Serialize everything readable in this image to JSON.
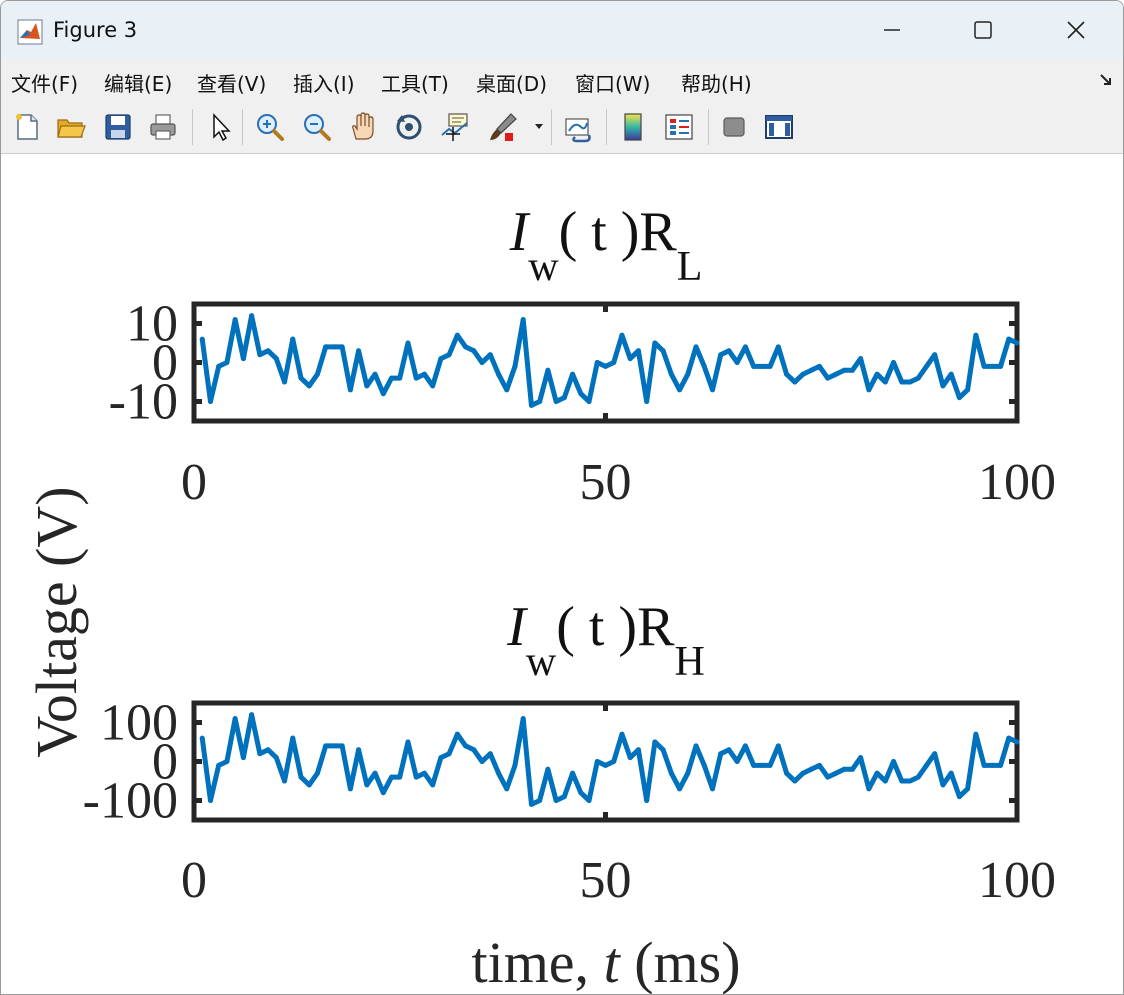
{
  "window": {
    "title": "Figure 3"
  },
  "menu": [
    {
      "label": "文件(F)"
    },
    {
      "label": "编辑(E)"
    },
    {
      "label": "查看(V)"
    },
    {
      "label": "插入(I)"
    },
    {
      "label": "工具(T)"
    },
    {
      "label": "桌面(D)"
    },
    {
      "label": "窗口(W)"
    },
    {
      "label": "帮助(H)"
    }
  ],
  "toolbar": {
    "icons": [
      "new-figure-icon",
      "open-icon",
      "save-icon",
      "print-icon",
      "pointer-icon",
      "zoom-in-icon",
      "zoom-out-icon",
      "pan-icon",
      "rotate-3d-icon",
      "data-cursor-icon",
      "brush-icon",
      "brush-dropdown-icon",
      "link-plot-icon",
      "colorbar-icon",
      "legend-icon",
      "hide-plot-tools-icon",
      "show-plot-tools-icon"
    ]
  },
  "colors": {
    "line": "#0072bd",
    "axes": "#262626",
    "titlebar": "#e9f1f7",
    "menubar": "#f0f0f0"
  },
  "figure": {
    "ylabel": "Voltage (V)",
    "xlabel": "time, t (ms)"
  },
  "chart_data": [
    {
      "type": "line",
      "title": "I_w( t )R_L",
      "title_parts": {
        "main": "I",
        "sub": "w",
        "mid": "( t )R",
        "sub2": "L"
      },
      "xlim": [
        0,
        100
      ],
      "ylim": [
        -15,
        15
      ],
      "xticks": [
        0,
        50,
        100
      ],
      "xtick_labels": [
        "0",
        "50",
        "100"
      ],
      "yticks": [
        10,
        0,
        -10
      ],
      "ytick_labels": [
        "10",
        "0",
        "-10"
      ],
      "x": [
        1,
        2,
        3,
        4,
        5,
        6,
        7,
        8,
        9,
        10,
        11,
        12,
        13,
        14,
        15,
        16,
        17,
        18,
        19,
        20,
        21,
        22,
        23,
        24,
        25,
        26,
        27,
        28,
        29,
        30,
        31,
        32,
        33,
        34,
        35,
        36,
        37,
        38,
        39,
        40,
        41,
        42,
        43,
        44,
        45,
        46,
        47,
        48,
        49,
        50,
        51,
        52,
        53,
        54,
        55,
        56,
        57,
        58,
        59,
        60,
        61,
        62,
        63,
        64,
        65,
        66,
        67,
        68,
        69,
        70,
        71,
        72,
        73,
        74,
        75,
        76,
        77,
        78,
        79,
        80,
        81,
        82,
        83,
        84,
        85,
        86,
        87,
        88,
        89,
        90,
        91,
        92,
        93,
        94,
        95,
        96,
        97,
        98,
        99,
        100
      ],
      "series": [
        {
          "values": [
            6,
            -10,
            -1,
            0,
            11,
            1,
            12,
            2,
            3,
            1,
            -5,
            6,
            -4,
            -6,
            -3,
            4,
            4,
            4,
            -7,
            3,
            -6,
            -3,
            -8,
            -4,
            -4,
            5,
            -4,
            -3,
            -6,
            1,
            2,
            7,
            4,
            3,
            0,
            2,
            -3,
            -7,
            -1,
            11,
            -11,
            -10,
            -2,
            -10,
            -9,
            -3,
            -8,
            -10,
            0,
            -1,
            0,
            7,
            1,
            3,
            -10,
            5,
            3,
            -3,
            -7,
            -3,
            4,
            -1,
            -7,
            2,
            3,
            0,
            4,
            -1,
            -1,
            -1,
            4,
            -3,
            -5,
            -3,
            -2,
            -1,
            -4,
            -3,
            -2,
            -2,
            1,
            -7,
            -3,
            -5,
            0,
            -5,
            -5,
            -4,
            -1,
            2,
            -6,
            -3,
            -9,
            -7,
            7,
            -1,
            -1,
            -1,
            6,
            5
          ]
        }
      ]
    },
    {
      "type": "line",
      "title": "I_w( t )R_H",
      "title_parts": {
        "main": "I",
        "sub": "w",
        "mid": "( t )R",
        "sub2": "H"
      },
      "xlim": [
        0,
        100
      ],
      "ylim": [
        -150,
        150
      ],
      "xticks": [
        0,
        50,
        100
      ],
      "xtick_labels": [
        "0",
        "50",
        "100"
      ],
      "yticks": [
        100,
        0,
        -100
      ],
      "ytick_labels": [
        "100",
        "0",
        "-100"
      ],
      "x": [
        1,
        2,
        3,
        4,
        5,
        6,
        7,
        8,
        9,
        10,
        11,
        12,
        13,
        14,
        15,
        16,
        17,
        18,
        19,
        20,
        21,
        22,
        23,
        24,
        25,
        26,
        27,
        28,
        29,
        30,
        31,
        32,
        33,
        34,
        35,
        36,
        37,
        38,
        39,
        40,
        41,
        42,
        43,
        44,
        45,
        46,
        47,
        48,
        49,
        50,
        51,
        52,
        53,
        54,
        55,
        56,
        57,
        58,
        59,
        60,
        61,
        62,
        63,
        64,
        65,
        66,
        67,
        68,
        69,
        70,
        71,
        72,
        73,
        74,
        75,
        76,
        77,
        78,
        79,
        80,
        81,
        82,
        83,
        84,
        85,
        86,
        87,
        88,
        89,
        90,
        91,
        92,
        93,
        94,
        95,
        96,
        97,
        98,
        99,
        100
      ],
      "series": [
        {
          "values": [
            60,
            -100,
            -10,
            0,
            110,
            10,
            120,
            20,
            30,
            10,
            -50,
            60,
            -40,
            -60,
            -30,
            40,
            40,
            40,
            -70,
            30,
            -60,
            -30,
            -80,
            -40,
            -40,
            50,
            -40,
            -30,
            -60,
            10,
            20,
            70,
            40,
            30,
            0,
            20,
            -30,
            -70,
            -10,
            110,
            -110,
            -100,
            -20,
            -100,
            -90,
            -30,
            -80,
            -100,
            0,
            -10,
            0,
            70,
            10,
            30,
            -100,
            50,
            30,
            -30,
            -70,
            -30,
            40,
            -10,
            -70,
            20,
            30,
            0,
            40,
            -10,
            -10,
            -10,
            40,
            -30,
            -50,
            -30,
            -20,
            -10,
            -40,
            -30,
            -20,
            -20,
            10,
            -70,
            -30,
            -50,
            0,
            -50,
            -50,
            -40,
            -10,
            20,
            -60,
            -30,
            -90,
            -70,
            70,
            -10,
            -10,
            -10,
            60,
            50
          ]
        }
      ]
    }
  ]
}
